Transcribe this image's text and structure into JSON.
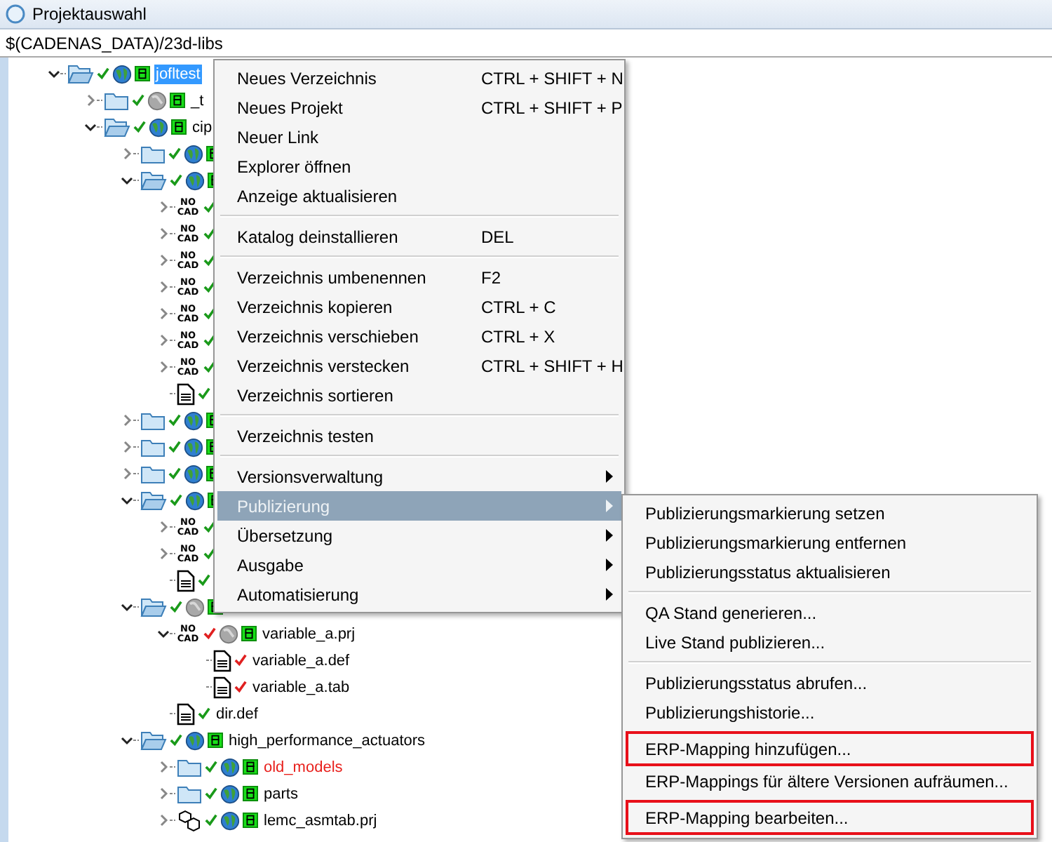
{
  "window": {
    "title": "Projektauswahl"
  },
  "path": "$(CADENAS_DATA)/23d-libs",
  "tree": [
    {
      "kind": "folder",
      "expanded": true,
      "error": false,
      "globe": true,
      "globe_inactive": false,
      "badge": true,
      "label": "jofltest",
      "selected": true,
      "children": [
        {
          "kind": "folder",
          "expanded": false,
          "error": false,
          "globe": true,
          "globe_inactive": true,
          "badge": true,
          "label": "_t",
          "selected": false
        },
        {
          "kind": "folder",
          "expanded": true,
          "error": false,
          "globe": true,
          "globe_inactive": false,
          "badge": true,
          "label": "cip",
          "selected": false,
          "children": [
            {
              "kind": "folder",
              "expanded": false,
              "error": false,
              "globe": true,
              "globe_inactive": false,
              "badge": true
            },
            {
              "kind": "folder",
              "expanded": true,
              "error": false,
              "globe": true,
              "globe_inactive": false,
              "badge": true,
              "children": [
                {
                  "kind": "nocad",
                  "icon_text": "NO CAD",
                  "expanded": false,
                  "error": false
                },
                {
                  "kind": "nocad",
                  "icon_text": "NO CAD",
                  "expanded": false,
                  "error": false
                },
                {
                  "kind": "nocad",
                  "icon_text": "NO CAD",
                  "expanded": false,
                  "error": false
                },
                {
                  "kind": "nocad",
                  "icon_text": "NO CAD",
                  "expanded": false,
                  "error": false
                },
                {
                  "kind": "nocad",
                  "icon_text": "NO CAD",
                  "expanded": false,
                  "error": false
                },
                {
                  "kind": "nocad",
                  "icon_text": "NO CAD",
                  "expanded": false,
                  "error": false
                },
                {
                  "kind": "nocad",
                  "icon_text": "NO CAD",
                  "expanded": false,
                  "error": false
                },
                {
                  "kind": "doc",
                  "error": false
                }
              ]
            },
            {
              "kind": "folder",
              "expanded": false,
              "error": false,
              "globe": true,
              "globe_inactive": false,
              "badge": true
            },
            {
              "kind": "folder",
              "expanded": false,
              "error": false,
              "globe": true,
              "globe_inactive": false,
              "badge": true
            },
            {
              "kind": "folder",
              "expanded": false,
              "error": false,
              "globe": true,
              "globe_inactive": false,
              "badge": true
            },
            {
              "kind": "folder",
              "expanded": true,
              "error": false,
              "globe": true,
              "globe_inactive": false,
              "badge": true,
              "children": [
                {
                  "kind": "nocad",
                  "icon_text": "NO CAD",
                  "expanded": false,
                  "error": false
                },
                {
                  "kind": "nocad",
                  "icon_text": "NO CAD",
                  "expanded": false,
                  "error": false
                },
                {
                  "kind": "doc",
                  "error": false
                }
              ]
            },
            {
              "kind": "folder",
              "expanded": true,
              "error": false,
              "globe": true,
              "globe_inactive": true,
              "badge": true,
              "children": [
                {
                  "kind": "nocad",
                  "icon_text": "NO CAD",
                  "expanded": true,
                  "error": true,
                  "globe": true,
                  "globe_inactive": true,
                  "badge": true,
                  "label": "variable_a.prj",
                  "selected": false,
                  "children": [
                    {
                      "kind": "doc",
                      "error": true,
                      "label": "variable_a.def",
                      "selected": false
                    },
                    {
                      "kind": "doc",
                      "error": true,
                      "label": "variable_a.tab",
                      "selected": false
                    }
                  ]
                },
                {
                  "kind": "doc",
                  "error": false,
                  "label": "dir.def",
                  "selected": false
                }
              ]
            },
            {
              "kind": "folder",
              "expanded": true,
              "error": false,
              "globe": true,
              "globe_inactive": false,
              "badge": true,
              "label": "high_performance_actuators",
              "selected": false,
              "children": [
                {
                  "kind": "folder",
                  "expanded": false,
                  "error": false,
                  "globe": true,
                  "globe_inactive": false,
                  "badge": true,
                  "label": "old_models",
                  "color": "#e8201c",
                  "selected": false
                },
                {
                  "kind": "folder",
                  "expanded": false,
                  "error": false,
                  "globe": true,
                  "globe_inactive": false,
                  "badge": true,
                  "label": "parts",
                  "selected": false
                },
                {
                  "kind": "assembly",
                  "expanded": false,
                  "error": false,
                  "globe": true,
                  "globe_inactive": false,
                  "badge": true,
                  "label": "lemc_asmtab.prj",
                  "selected": false
                }
              ]
            }
          ]
        }
      ]
    }
  ],
  "context_menu": {
    "items": [
      {
        "kind": "item",
        "label": "Neues Verzeichnis",
        "shortcut": "CTRL + SHIFT + N",
        "selected": false
      },
      {
        "kind": "item",
        "label": "Neues Projekt",
        "shortcut": "CTRL + SHIFT + P",
        "selected": false
      },
      {
        "kind": "item",
        "label": "Neuer Link",
        "selected": false
      },
      {
        "kind": "item",
        "label": "Explorer öffnen",
        "selected": false
      },
      {
        "kind": "item",
        "label": "Anzeige aktualisieren",
        "selected": false
      },
      {
        "kind": "separator"
      },
      {
        "kind": "item",
        "label": "Katalog deinstallieren",
        "shortcut": "DEL",
        "selected": false
      },
      {
        "kind": "separator"
      },
      {
        "kind": "item",
        "label": "Verzeichnis umbenennen",
        "shortcut": "F2",
        "selected": false
      },
      {
        "kind": "item",
        "label": "Verzeichnis kopieren",
        "shortcut": "CTRL + C",
        "selected": false
      },
      {
        "kind": "item",
        "label": "Verzeichnis verschieben",
        "shortcut": "CTRL + X",
        "selected": false
      },
      {
        "kind": "item",
        "label": "Verzeichnis verstecken",
        "shortcut": "CTRL + SHIFT + H",
        "selected": false
      },
      {
        "kind": "item",
        "label": "Verzeichnis sortieren",
        "selected": false
      },
      {
        "kind": "separator"
      },
      {
        "kind": "item",
        "label": "Verzeichnis testen",
        "selected": false
      },
      {
        "kind": "separator"
      },
      {
        "kind": "submenu",
        "label": "Versionsverwaltung",
        "selected": false
      },
      {
        "kind": "submenu",
        "label": "Publizierung",
        "selected": true
      },
      {
        "kind": "submenu",
        "label": "Übersetzung",
        "selected": false
      },
      {
        "kind": "submenu",
        "label": "Ausgabe",
        "selected": false
      },
      {
        "kind": "submenu",
        "label": "Automatisierung",
        "selected": false
      }
    ]
  },
  "submenu": {
    "items": [
      {
        "kind": "item",
        "label": "Publizierungsmarkierung setzen",
        "outlined": false
      },
      {
        "kind": "item",
        "label": "Publizierungsmarkierung entfernen",
        "outlined": false
      },
      {
        "kind": "item",
        "label": "Publizierungsstatus aktualisieren",
        "outlined": false
      },
      {
        "kind": "separator"
      },
      {
        "kind": "item",
        "label": "QA Stand generieren...",
        "outlined": false
      },
      {
        "kind": "item",
        "label": "Live Stand publizieren...",
        "outlined": false
      },
      {
        "kind": "separator"
      },
      {
        "kind": "item",
        "label": "Publizierungsstatus abrufen...",
        "outlined": false
      },
      {
        "kind": "item",
        "label": "Publizierungshistorie...",
        "outlined": false
      },
      {
        "kind": "item",
        "label": "ERP-Mapping hinzufügen...",
        "outlined": true
      },
      {
        "kind": "item",
        "label": "ERP-Mappings für ältere Versionen aufräumen...",
        "outlined": false
      },
      {
        "kind": "item",
        "label": "ERP-Mapping bearbeiten...",
        "outlined": true
      }
    ]
  }
}
